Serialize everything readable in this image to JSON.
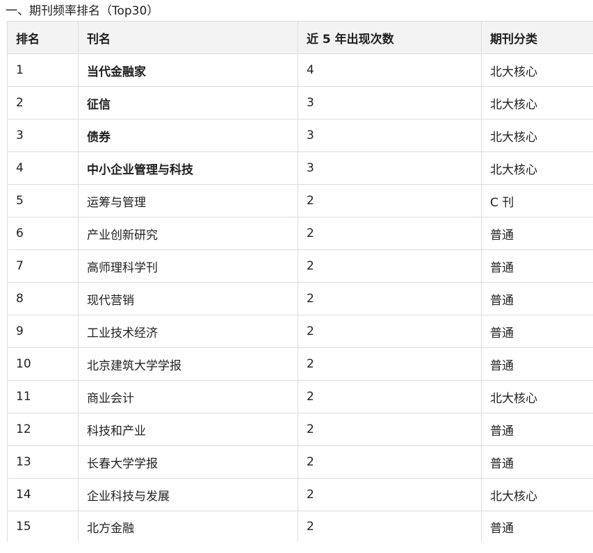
{
  "heading": "一、期刊频率排名（Top30）",
  "table": {
    "headers": [
      "排名",
      "刊名",
      "近 5 年出现次数",
      "期刊分类"
    ],
    "rows": [
      {
        "rank": "1",
        "name": "当代金融家",
        "count": "4",
        "category": "北大核心",
        "bold": true
      },
      {
        "rank": "2",
        "name": "征信",
        "count": "3",
        "category": "北大核心",
        "bold": true
      },
      {
        "rank": "3",
        "name": "债券",
        "count": "3",
        "category": "北大核心",
        "bold": true
      },
      {
        "rank": "4",
        "name": "中小企业管理与科技",
        "count": "3",
        "category": "北大核心",
        "bold": true
      },
      {
        "rank": "5",
        "name": "运筹与管理",
        "count": "2",
        "category": "C 刊",
        "bold": false
      },
      {
        "rank": "6",
        "name": "产业创新研究",
        "count": "2",
        "category": "普通",
        "bold": false
      },
      {
        "rank": "7",
        "name": "高师理科学刊",
        "count": "2",
        "category": "普通",
        "bold": false
      },
      {
        "rank": "8",
        "name": "现代营销",
        "count": "2",
        "category": "普通",
        "bold": false
      },
      {
        "rank": "9",
        "name": "工业技术经济",
        "count": "2",
        "category": "普通",
        "bold": false
      },
      {
        "rank": "10",
        "name": "北京建筑大学学报",
        "count": "2",
        "category": "普通",
        "bold": false
      },
      {
        "rank": "11",
        "name": "商业会计",
        "count": "2",
        "category": "北大核心",
        "bold": false
      },
      {
        "rank": "12",
        "name": "科技和产业",
        "count": "2",
        "category": "普通",
        "bold": false
      },
      {
        "rank": "13",
        "name": "长春大学学报",
        "count": "2",
        "category": "普通",
        "bold": false
      },
      {
        "rank": "14",
        "name": "企业科技与发展",
        "count": "2",
        "category": "北大核心",
        "bold": false
      },
      {
        "rank": "15",
        "name": "北方金融",
        "count": "2",
        "category": "普通",
        "bold": false
      }
    ]
  }
}
